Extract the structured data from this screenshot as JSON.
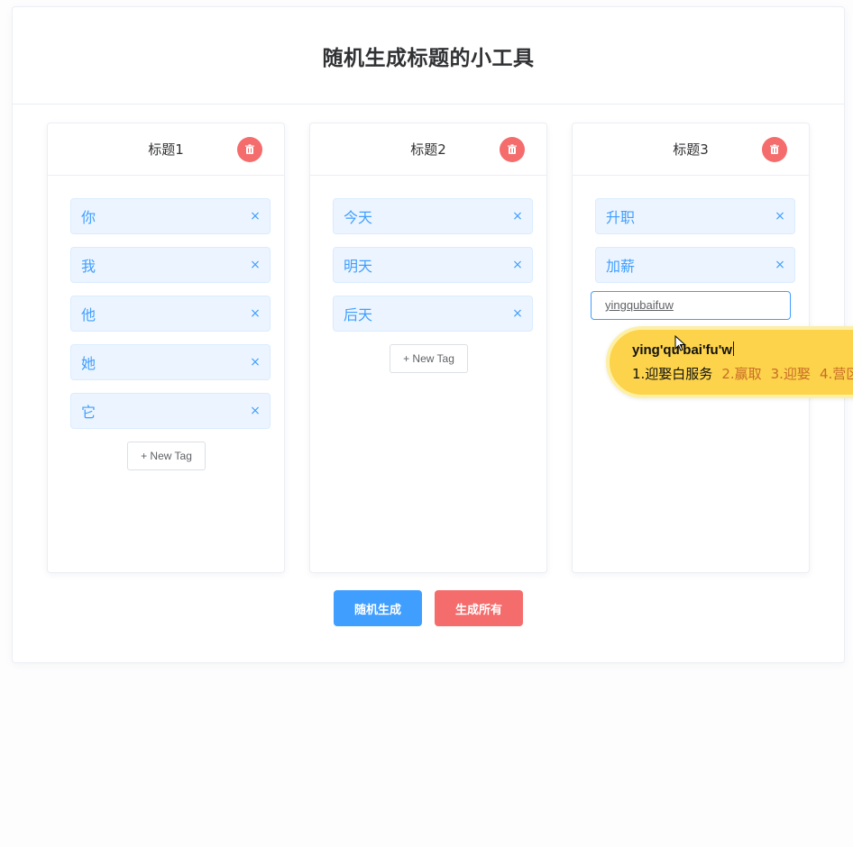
{
  "app": {
    "title": "随机生成标题的小工具"
  },
  "columns": [
    {
      "title": "标题1",
      "tags": [
        "你",
        "我",
        "他",
        "她",
        "它"
      ],
      "new_tag_label": "+ New Tag"
    },
    {
      "title": "标题2",
      "tags": [
        "今天",
        "明天",
        "后天"
      ],
      "new_tag_label": "+ New Tag"
    },
    {
      "title": "标题3",
      "tags": [
        "升职",
        "加薪"
      ],
      "input_value": "yingqubaifuw"
    }
  ],
  "footer": {
    "random_label": "随机生成",
    "all_label": "生成所有"
  },
  "ime": {
    "composition": "ying'qu'bai'fu'w",
    "candidates": [
      "1.迎娶白服务",
      "2.赢取",
      "3.迎娶",
      "4.营区"
    ]
  },
  "colors": {
    "primary": "#409eff",
    "danger": "#f56c6c",
    "tag_bg": "#ecf5ff",
    "ime_bg": "#fcd34a"
  },
  "icons": {
    "delete": "trash-icon",
    "close": "close-icon"
  }
}
